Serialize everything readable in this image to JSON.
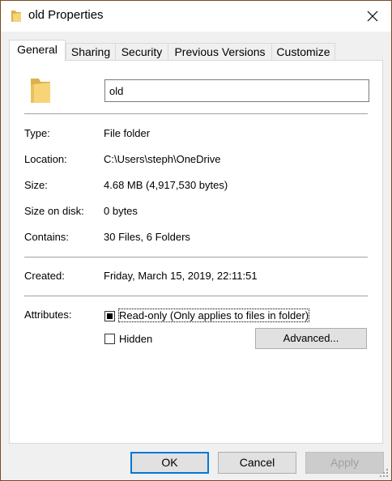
{
  "window": {
    "title": "old Properties"
  },
  "tabs": [
    {
      "label": "General"
    },
    {
      "label": "Sharing"
    },
    {
      "label": "Security"
    },
    {
      "label": "Previous Versions"
    },
    {
      "label": "Customize"
    }
  ],
  "general": {
    "name": "old",
    "type_label": "Type:",
    "type_value": "File folder",
    "location_label": "Location:",
    "location_value": "C:\\Users\\steph\\OneDrive",
    "size_label": "Size:",
    "size_value": "4.68 MB (4,917,530 bytes)",
    "size_on_disk_label": "Size on disk:",
    "size_on_disk_value": "0 bytes",
    "contains_label": "Contains:",
    "contains_value": "30 Files, 6 Folders",
    "created_label": "Created:",
    "created_value": "Friday, March 15, 2019, 22:11:51",
    "attributes_label": "Attributes:",
    "readonly_label": "Read-only (Only applies to files in folder)",
    "hidden_label": "Hidden",
    "advanced_label": "Advanced...",
    "readonly_state": "indeterminate",
    "hidden_checked": false
  },
  "buttons": {
    "ok": "OK",
    "cancel": "Cancel",
    "apply": "Apply"
  },
  "colors": {
    "accent": "#0078d7",
    "folder": "#f0c861",
    "window_border": "#7a4a22"
  }
}
